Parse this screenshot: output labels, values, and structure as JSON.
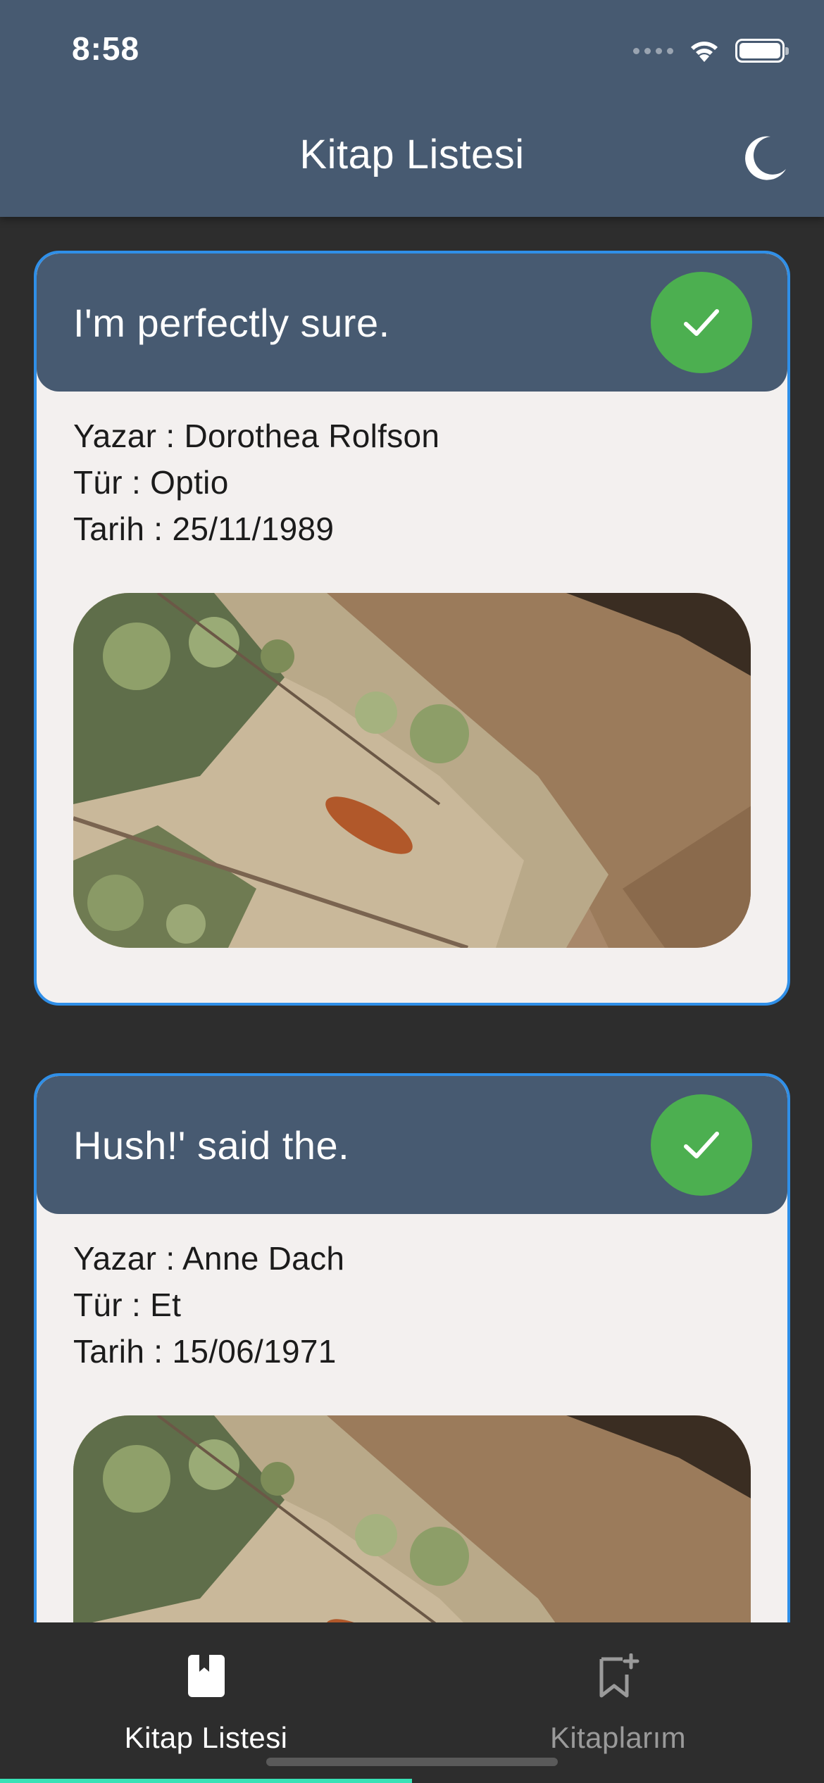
{
  "status_bar": {
    "time": "8:58"
  },
  "app_bar": {
    "title": "Kitap Listesi",
    "theme_icon": "moon-icon"
  },
  "books": [
    {
      "title": "I'm perfectly sure.",
      "author_line": "Yazar  : Dorothea Rolfson",
      "genre_line": "Tür  : Optio",
      "date_line": "Tarih  : 25/11/1989",
      "read": true
    },
    {
      "title": "Hush!' said the.",
      "author_line": "Yazar  : Anne Dach",
      "genre_line": "Tür  : Et",
      "date_line": "Tarih  : 15/06/1971",
      "read": true
    }
  ],
  "bottom_nav": {
    "items": [
      {
        "label": "Kitap Listesi",
        "icon": "book-icon",
        "active": true
      },
      {
        "label": "Kitaplarım",
        "icon": "bookmark-add-icon",
        "active": false
      }
    ]
  },
  "colors": {
    "app_bar": "#475a71",
    "background": "#2d2d2d",
    "card": "#f3f0ef",
    "card_border": "#2f8fe8",
    "check": "#4caf50",
    "nav_indicator": "#38e2b6"
  }
}
